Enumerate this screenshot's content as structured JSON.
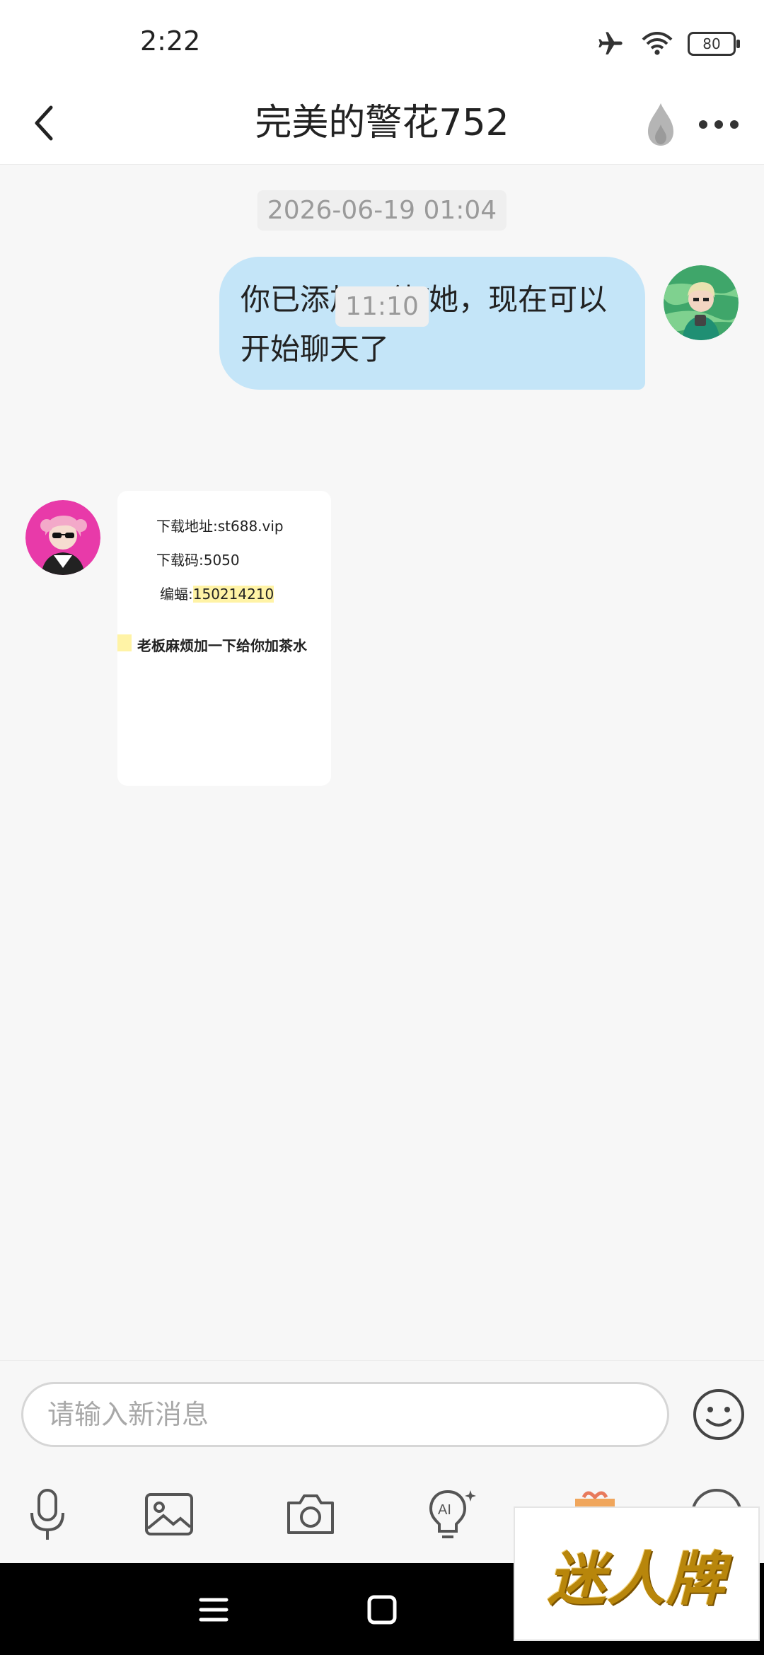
{
  "status_bar": {
    "time": "2:22",
    "battery": "80"
  },
  "header": {
    "title": "完美的警花752"
  },
  "chat": {
    "timestamp_1": "2026-06-19 01:04",
    "outgoing_message": "你已添加了他/她，现在可以开始聊天了",
    "timestamp_2": "11:10",
    "image_message": {
      "line_1": "下载地址:st688.vip",
      "line_2": "下载码:5050",
      "line_3_label": "编蝠:",
      "line_3_value": "150214210",
      "line_4": "老板麻烦加一下给你加茶水"
    }
  },
  "input": {
    "placeholder": "请输入新消息"
  },
  "watermark": {
    "text": "迷人牌"
  },
  "colors": {
    "bubble_out": "#c4e5f8",
    "highlight": "#fff3a6",
    "background": "#f7f7f7"
  }
}
